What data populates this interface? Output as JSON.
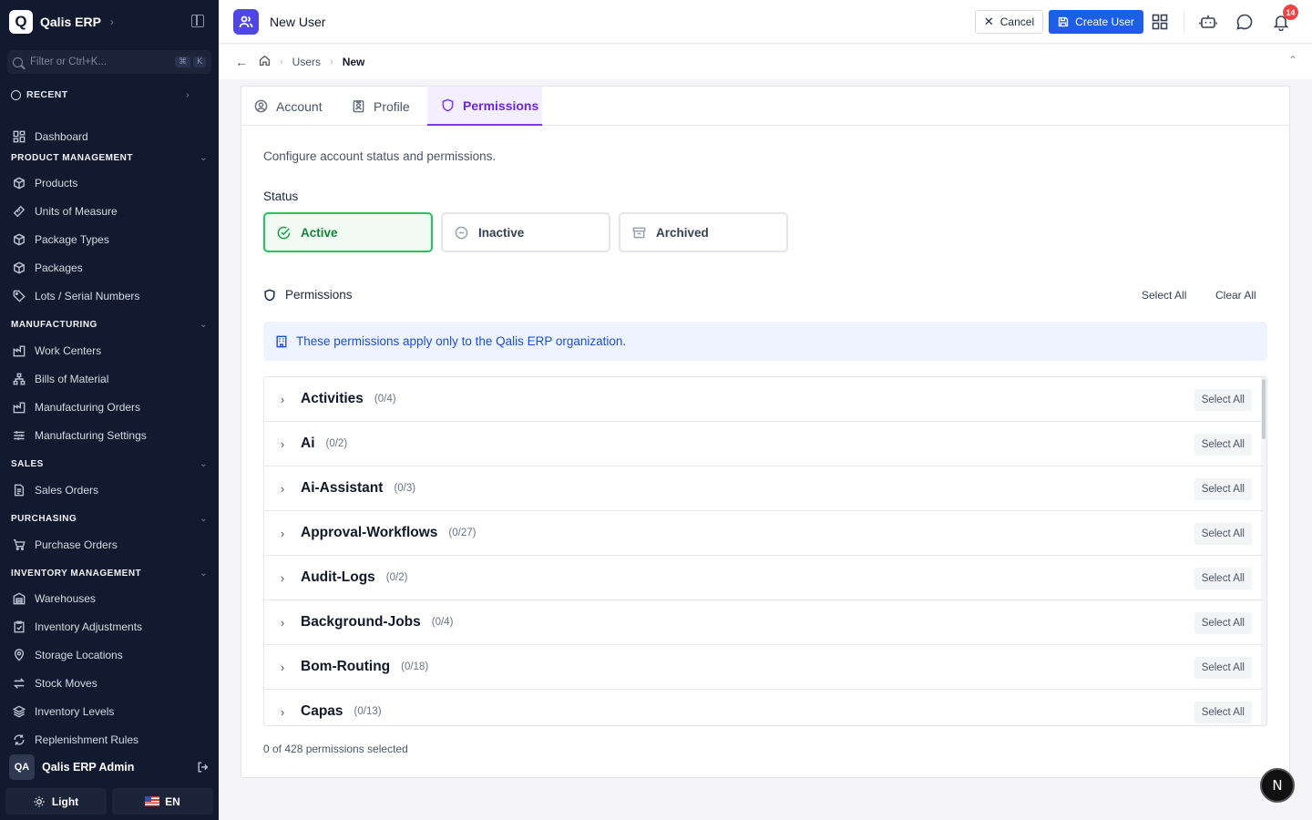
{
  "sidebar": {
    "brand": "Qalis ERP",
    "logo": "Q",
    "search_placeholder": "Filter or Ctrl+K...",
    "kbd1": "⌘",
    "kbd2": "K",
    "recent": "RECENT",
    "dashboard": "Dashboard",
    "sections": {
      "product": "PRODUCT MANAGEMENT",
      "manufacturing": "MANUFACTURING",
      "sales": "SALES",
      "purchasing": "PURCHASING",
      "inventory": "INVENTORY MANAGEMENT"
    },
    "items": {
      "products": "Products",
      "uom": "Units of Measure",
      "package_types": "Package Types",
      "packages": "Packages",
      "lots": "Lots / Serial Numbers",
      "work_centers": "Work Centers",
      "bom": "Bills of Material",
      "mfg_orders": "Manufacturing Orders",
      "mfg_settings": "Manufacturing Settings",
      "sales_orders": "Sales Orders",
      "purchase_orders": "Purchase Orders",
      "warehouses": "Warehouses",
      "inv_adjust": "Inventory Adjustments",
      "storage": "Storage Locations",
      "stock_moves": "Stock Moves",
      "inv_levels": "Inventory Levels",
      "replenish": "Replenishment Rules"
    },
    "user_initials": "QA",
    "user_name": "Qalis ERP Admin",
    "theme_label": "Light",
    "lang_label": "EN"
  },
  "header": {
    "title": "New User",
    "cancel": "Cancel",
    "create": "Create User",
    "notif_count": "14"
  },
  "breadcrumb": {
    "users": "Users",
    "current": "New"
  },
  "tabs": {
    "account": "Account",
    "profile": "Profile",
    "permissions": "Permissions"
  },
  "form": {
    "intro": "Configure account status and permissions.",
    "status_label": "Status",
    "status_active": "Active",
    "status_inactive": "Inactive",
    "status_archived": "Archived",
    "permissions_title": "Permissions",
    "select_all": "Select All",
    "clear_all": "Clear All",
    "info": "These permissions apply only to the Qalis ERP organization.",
    "summary": "0 of 428 permissions selected"
  },
  "permissions": [
    {
      "name": "Activities",
      "count": "(0/4)",
      "action": "Select All"
    },
    {
      "name": "Ai",
      "count": "(0/2)",
      "action": "Select All"
    },
    {
      "name": "Ai-Assistant",
      "count": "(0/3)",
      "action": "Select All"
    },
    {
      "name": "Approval-Workflows",
      "count": "(0/27)",
      "action": "Select All"
    },
    {
      "name": "Audit-Logs",
      "count": "(0/2)",
      "action": "Select All"
    },
    {
      "name": "Background-Jobs",
      "count": "(0/4)",
      "action": "Select All"
    },
    {
      "name": "Bom-Routing",
      "count": "(0/18)",
      "action": "Select All"
    },
    {
      "name": "Capas",
      "count": "(0/13)",
      "action": "Select All"
    }
  ],
  "fab_label": "N"
}
